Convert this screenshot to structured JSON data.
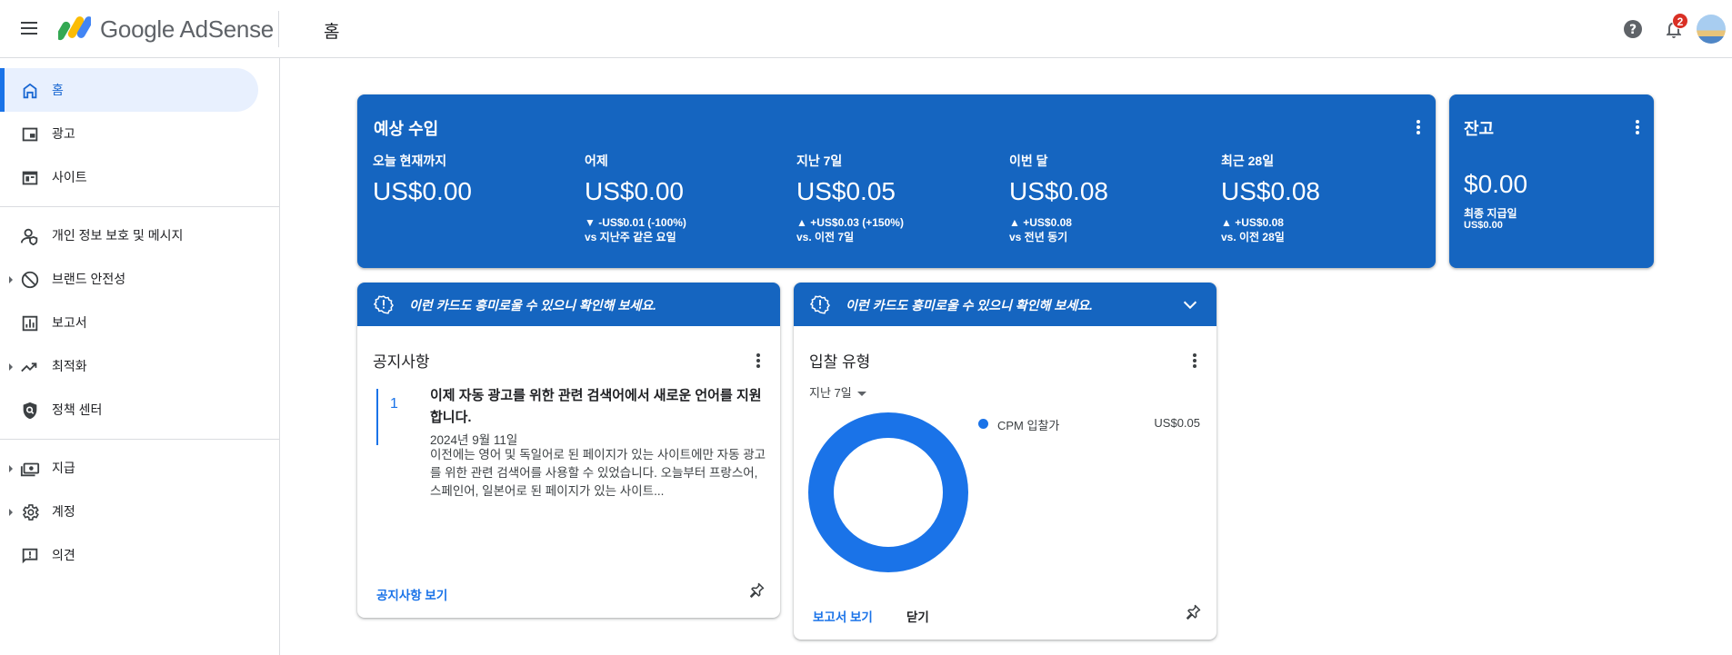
{
  "header": {
    "logo_text": "Google AdSense",
    "page_title": "홈",
    "notification_count": "2"
  },
  "sidebar": {
    "items": [
      {
        "label": "홈",
        "icon": "home-icon"
      },
      {
        "label": "광고",
        "icon": "ads-icon"
      },
      {
        "label": "사이트",
        "icon": "sites-icon"
      },
      {
        "label": "개인 정보 보호 및 메시지",
        "icon": "privacy-icon"
      },
      {
        "label": "브랜드 안전성",
        "icon": "block-icon"
      },
      {
        "label": "보고서",
        "icon": "reports-icon"
      },
      {
        "label": "최적화",
        "icon": "trending-icon"
      },
      {
        "label": "정책 센터",
        "icon": "policy-icon"
      },
      {
        "label": "지급",
        "icon": "payments-icon"
      },
      {
        "label": "계정",
        "icon": "gear-icon"
      },
      {
        "label": "의견",
        "icon": "feedback-icon"
      }
    ]
  },
  "earnings": {
    "title": "예상 수입",
    "metrics": [
      {
        "label": "오늘 현재까지",
        "value": "US$0.00",
        "change": "",
        "compare": ""
      },
      {
        "label": "어제",
        "value": "US$0.00",
        "change": "▼ -US$0.01 (-100%)",
        "compare": "vs 지난주 같은 요일"
      },
      {
        "label": "지난 7일",
        "value": "US$0.05",
        "change": "▲ +US$0.03 (+150%)",
        "compare": "vs. 이전 7일"
      },
      {
        "label": "이번 달",
        "value": "US$0.08",
        "change": "▲ +US$0.08",
        "compare": "vs 전년 동기"
      },
      {
        "label": "최근 28일",
        "value": "US$0.08",
        "change": "▲ +US$0.08",
        "compare": "vs. 이전 28일"
      }
    ]
  },
  "balance": {
    "title": "잔고",
    "value": "$0.00",
    "last_payment_label": "최종 지급일",
    "last_payment_value": "US$0.00"
  },
  "notice_card": {
    "banner": "이런 카드도 흥미로울 수 있으니 확인해 보세요.",
    "title": "공지사항",
    "item_number": "1",
    "headline": "이제 자동 광고를 위한 관련 검색어에서 새로운 언어를 지원합니다.",
    "date": "2024년 9월 11일",
    "body": "이전에는 영어 및 독일어로 된 페이지가 있는 사이트에만 자동 광고를 위한 관련 검색어를 사용할 수 있었습니다. 오늘부터 프랑스어, 스페인어, 일본어로 된 페이지가 있는 사이트...",
    "link": "공지사항 보기"
  },
  "bid_card": {
    "banner": "이런 카드도 흥미로울 수 있으니 확인해 보세요.",
    "title": "입찰 유형",
    "period": "지난 7일",
    "legend_name": "CPM 입찰가",
    "legend_value": "US$0.05",
    "link_report": "보고서 보기",
    "link_close": "닫기"
  },
  "colors": {
    "brand_blue": "#1565c0",
    "accent_blue": "#1a73e8",
    "chart_blue": "#1a73e8"
  },
  "chart_data": {
    "type": "pie",
    "categories": [
      "CPM 입찰가"
    ],
    "values": [
      0.05
    ],
    "title": "",
    "legend": "right"
  }
}
